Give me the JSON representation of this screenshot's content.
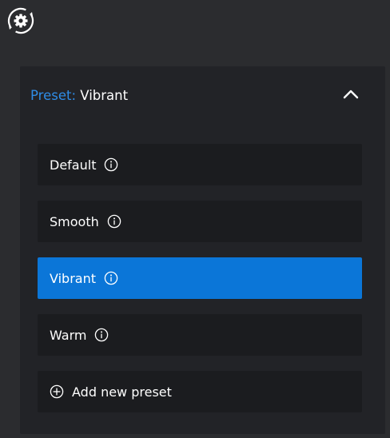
{
  "app": {
    "icon": "gear-refresh-icon"
  },
  "preset": {
    "label": "Preset:",
    "value": "Vibrant",
    "label_color": "#2f8ce6",
    "chevron_icon": "chevron-up-icon",
    "items": [
      {
        "label": "Default",
        "info_icon": "info-icon"
      },
      {
        "label": "Smooth",
        "info_icon": "info-icon"
      },
      {
        "label": "Vibrant",
        "info_icon": "info-icon",
        "selected": true
      },
      {
        "label": "Warm",
        "info_icon": "info-icon"
      }
    ],
    "add_label": "Add new preset",
    "add_icon": "plus-circle-icon",
    "accent_color": "#0b76d8"
  }
}
